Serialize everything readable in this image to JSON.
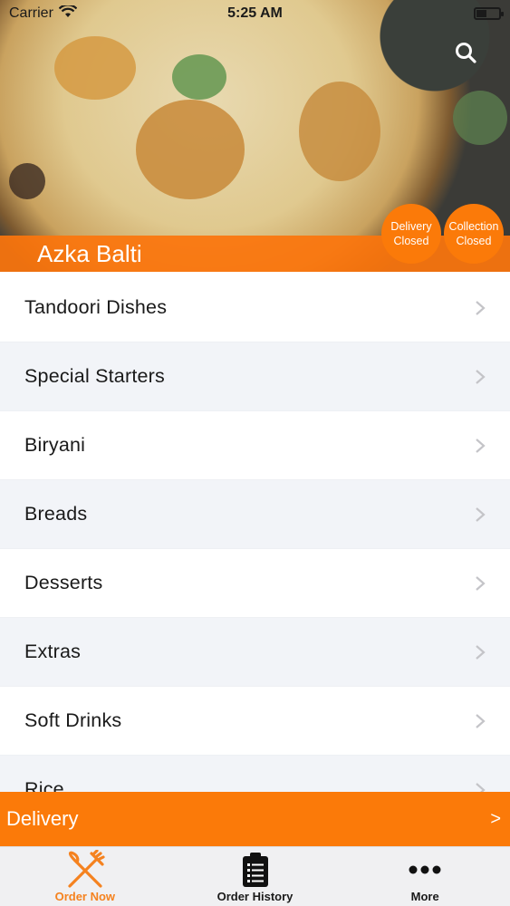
{
  "status_bar": {
    "carrier": "Carrier",
    "time": "5:25 AM",
    "battery_level": 0.45
  },
  "header": {
    "restaurant_name": "Azka Balti",
    "search_icon": "search-icon",
    "badges": {
      "delivery": {
        "line1": "Delivery",
        "line2": "Closed"
      },
      "collection": {
        "line1": "Collection",
        "line2": "Closed"
      }
    }
  },
  "categories": [
    {
      "label": "Tandoori Dishes"
    },
    {
      "label": "Special Starters"
    },
    {
      "label": "Biryani"
    },
    {
      "label": "Breads"
    },
    {
      "label": "Desserts"
    },
    {
      "label": "Extras"
    },
    {
      "label": "Soft Drinks"
    },
    {
      "label": "Rice"
    }
  ],
  "delivery_bar": {
    "label": "Delivery",
    "arrow": ">"
  },
  "tabs": [
    {
      "label": "Order Now",
      "icon": "fork-knife-icon",
      "active": true
    },
    {
      "label": "Order History",
      "icon": "clipboard-list-icon",
      "active": false
    },
    {
      "label": "More",
      "icon": "more-dots-icon",
      "active": false
    }
  ],
  "colors": {
    "accent": "#fb7a09",
    "active_tab": "#f5821f"
  }
}
